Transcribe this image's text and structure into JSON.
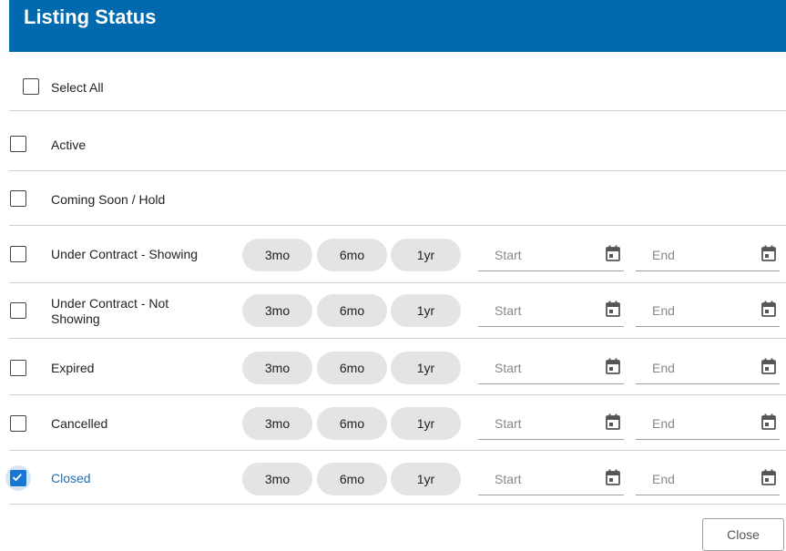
{
  "header": {
    "title": "Listing Status"
  },
  "select_all": {
    "label": "Select All",
    "checked": false
  },
  "statuses": [
    {
      "label": "Active",
      "checked": false
    },
    {
      "label": "Coming Soon / Hold",
      "checked": false
    },
    {
      "label": "Under Contract - Showing",
      "checked": false
    },
    {
      "label": "Under Contract - Not Showing",
      "checked": false
    },
    {
      "label": "Expired",
      "checked": false
    },
    {
      "label": "Cancelled",
      "checked": false
    },
    {
      "label": "Closed",
      "checked": true
    }
  ],
  "range_buttons": [
    "3mo",
    "6mo",
    "1yr"
  ],
  "date_fields": {
    "start_placeholder": "Start",
    "end_placeholder": "End",
    "icon": "calendar-icon"
  },
  "footer": {
    "close_label": "Close"
  },
  "colors": {
    "header_bg": "#0169ae",
    "accent": "#1976d2",
    "selected_text": "#1a6fb7"
  }
}
